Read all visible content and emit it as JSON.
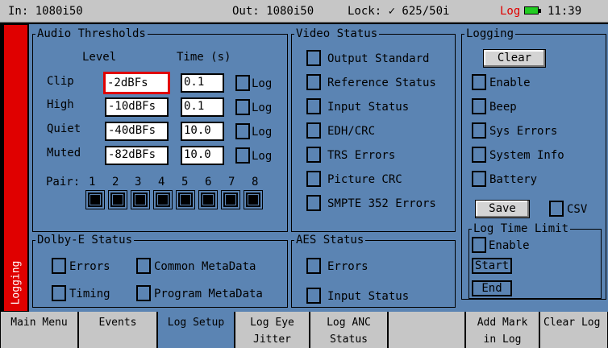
{
  "status_bar": {
    "input": "In: 1080i50",
    "output": "Out: 1080i50",
    "lock": "Lock: ✓ 625/50i",
    "log": "Log",
    "time": "11:39"
  },
  "side_tab": {
    "label": "Logging"
  },
  "audio_thresholds": {
    "title": "Audio Thresholds",
    "col_level": "Level",
    "col_time": "Time (s)",
    "log_label": "Log",
    "rows": [
      {
        "label": "Clip",
        "level": "-2dBFs",
        "time": "0.1"
      },
      {
        "label": "High",
        "level": "-10dBFs",
        "time": "0.1"
      },
      {
        "label": "Quiet",
        "level": "-40dBFs",
        "time": "10.0"
      },
      {
        "label": "Muted",
        "level": "-82dBFs",
        "time": "10.0"
      }
    ],
    "pair_label": "Pair:",
    "pairs": [
      "1",
      "2",
      "3",
      "4",
      "5",
      "6",
      "7",
      "8"
    ]
  },
  "video_status": {
    "title": "Video Status",
    "items": [
      "Output Standard",
      "Reference Status",
      "Input Status",
      "EDH/CRC",
      "TRS Errors",
      "Picture CRC",
      "SMPTE 352 Errors"
    ]
  },
  "logging": {
    "title": "Logging",
    "clear_label": "Clear",
    "items": [
      "Enable",
      "Beep",
      "Sys Errors",
      "System Info",
      "Battery"
    ],
    "save_label": "Save",
    "csv_label": "CSV"
  },
  "log_time_limit": {
    "title": "Log Time Limit",
    "enable_label": "Enable",
    "start_label": "Start",
    "end_label": "End"
  },
  "dolby_status": {
    "title": "Dolby-E Status",
    "errors": "Errors",
    "common_metadata": "Common MetaData",
    "timing": "Timing",
    "program_metadata": "Program MetaData"
  },
  "aes_status": {
    "title": "AES Status",
    "errors": "Errors",
    "input_status": "Input Status"
  },
  "menu": [
    {
      "line1": "Main Menu",
      "line2": ""
    },
    {
      "line1": "Events",
      "line2": ""
    },
    {
      "line1": "Log Setup",
      "line2": ""
    },
    {
      "line1": "Log Eye",
      "line2": "Jitter"
    },
    {
      "line1": "Log ANC",
      "line2": "Status"
    },
    {
      "line1": "",
      "line2": ""
    },
    {
      "line1": "Add Mark",
      "line2": "in Log"
    },
    {
      "line1": "Clear Log",
      "line2": ""
    }
  ],
  "colors": {
    "panel": "#5b84b3",
    "alert": "#e00000",
    "battery": "#22cc22"
  }
}
